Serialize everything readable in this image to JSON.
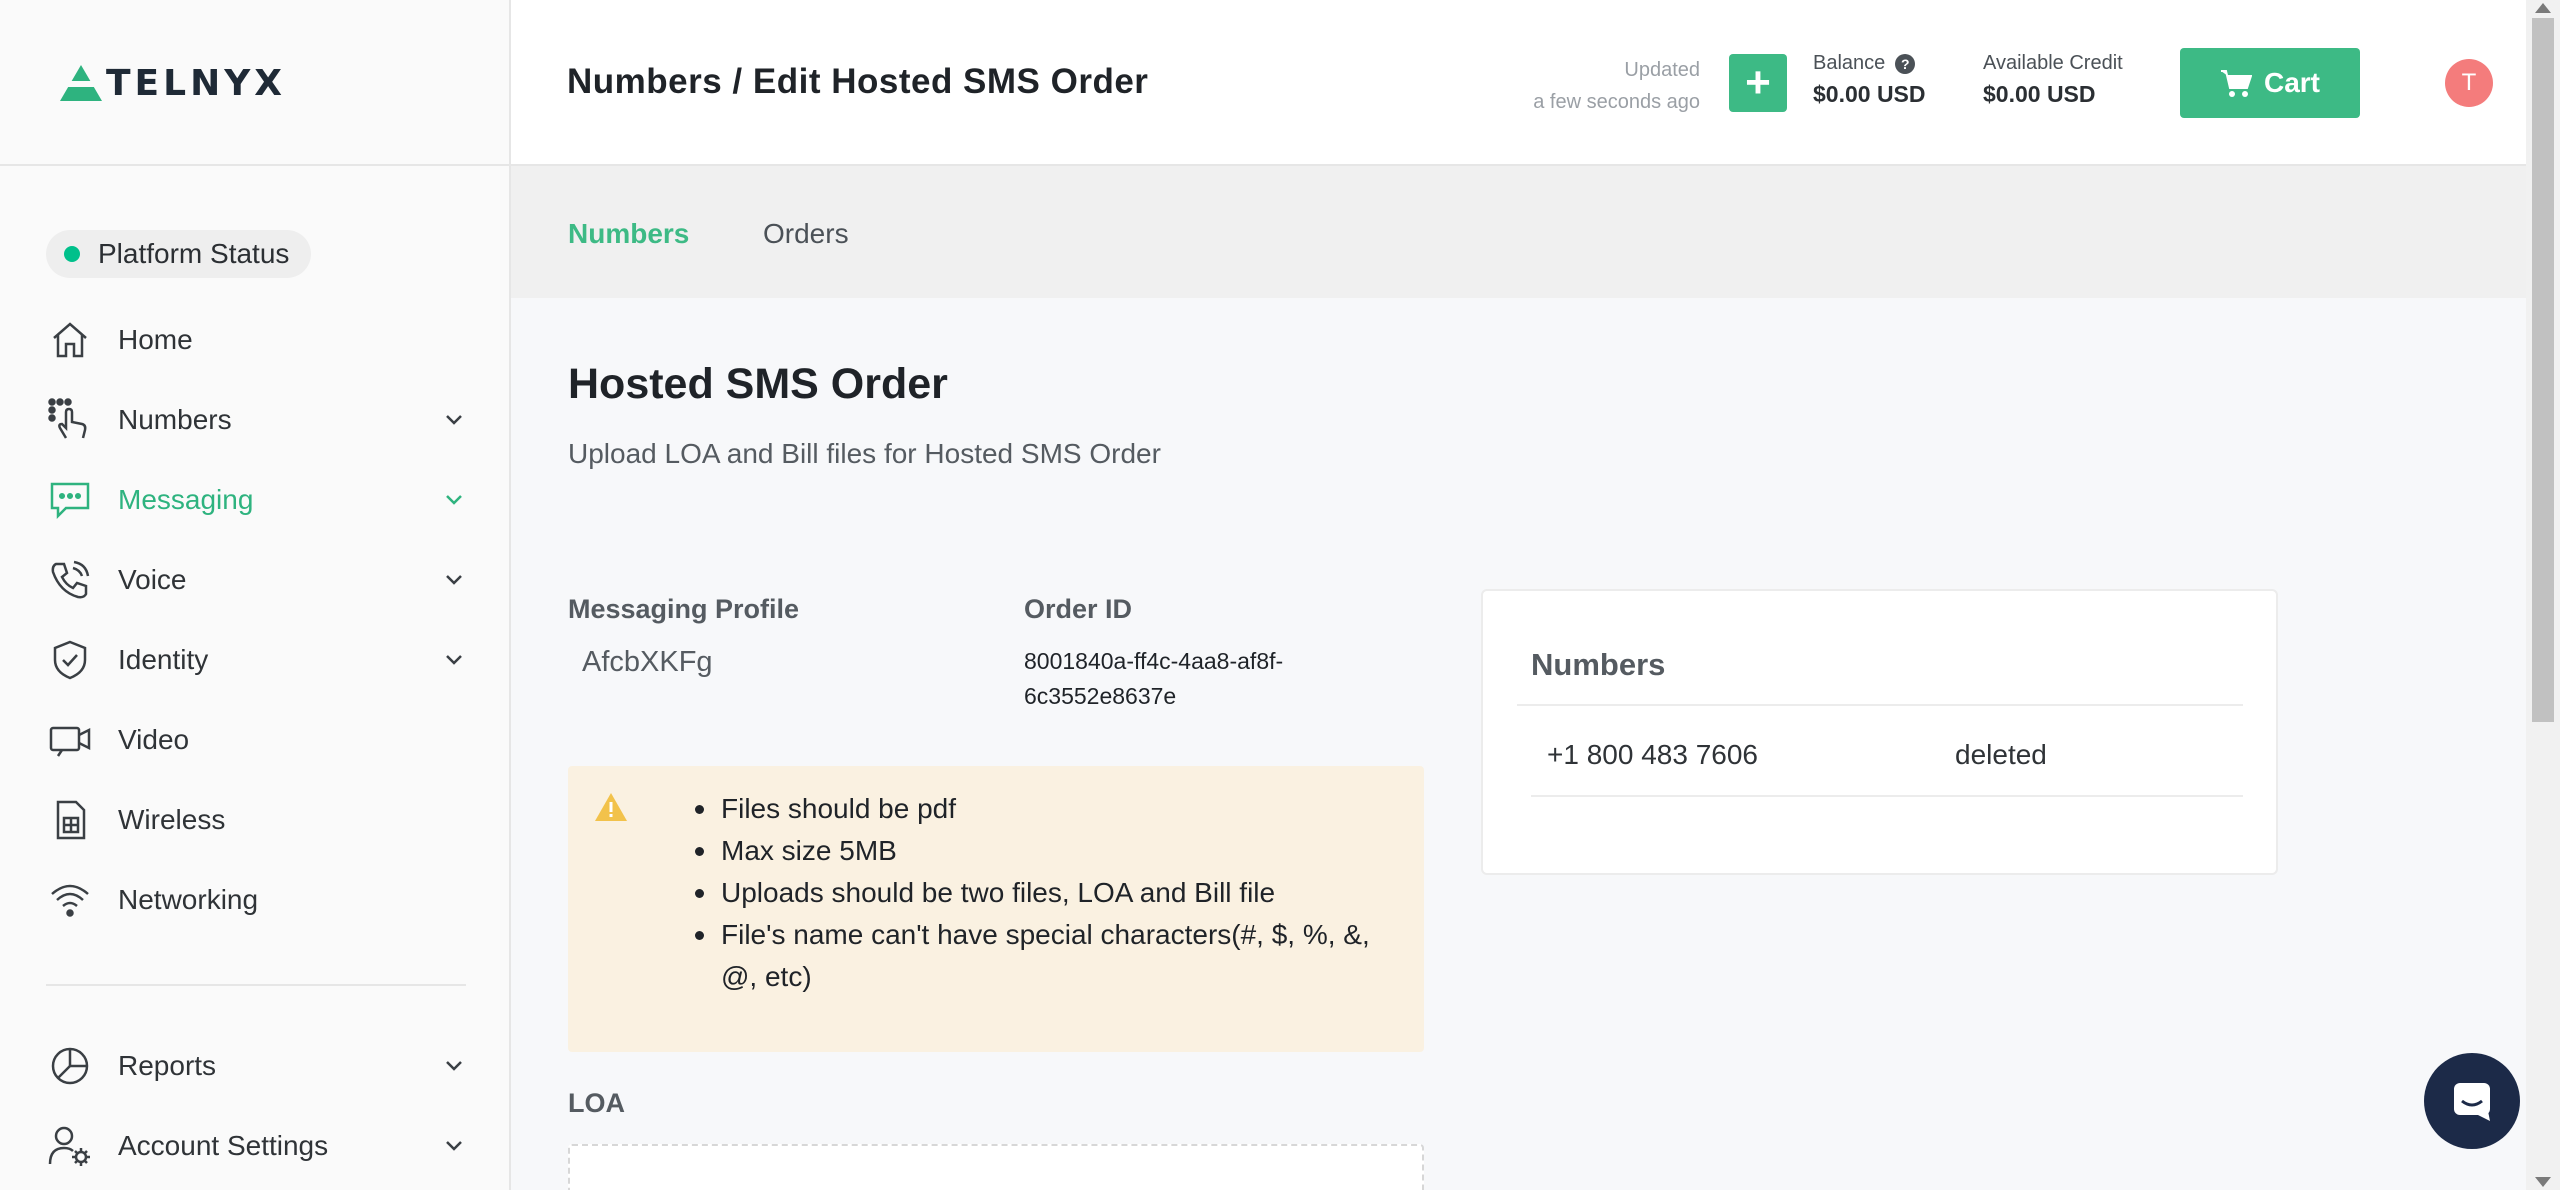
{
  "brand": {
    "name": "TELNYX",
    "accent": "#3dba85",
    "logo_color": "#1f2a36"
  },
  "sidebar": {
    "status": {
      "label": "Platform Status",
      "dot_color": "#00c08b"
    },
    "items": [
      {
        "label": "Home",
        "icon": "home-icon",
        "expandable": false,
        "active": false
      },
      {
        "label": "Numbers",
        "icon": "dialpad-touch-icon",
        "expandable": true,
        "active": false
      },
      {
        "label": "Messaging",
        "icon": "message-icon",
        "expandable": true,
        "active": true
      },
      {
        "label": "Voice",
        "icon": "phone-icon",
        "expandable": true,
        "active": false
      },
      {
        "label": "Identity",
        "icon": "shield-check-icon",
        "expandable": true,
        "active": false
      },
      {
        "label": "Video",
        "icon": "video-icon",
        "expandable": false,
        "active": false
      },
      {
        "label": "Wireless",
        "icon": "sim-card-icon",
        "expandable": false,
        "active": false
      },
      {
        "label": "Networking",
        "icon": "wifi-icon",
        "expandable": false,
        "active": false
      }
    ],
    "bottom_items": [
      {
        "label": "Reports",
        "icon": "pie-chart-icon",
        "expandable": true
      },
      {
        "label": "Account Settings",
        "icon": "user-gear-icon",
        "expandable": true
      }
    ]
  },
  "header": {
    "title": "Numbers / Edit Hosted SMS Order",
    "updated_label": "Updated",
    "updated_time": "a few seconds ago",
    "add_label": "+",
    "balance_label": "Balance",
    "balance_value": "$0.00 USD",
    "credit_label": "Available Credit",
    "credit_value": "$0.00 USD",
    "cart_label": "Cart",
    "avatar_initial": "T",
    "avatar_color": "#f47c7c"
  },
  "subnav": {
    "tabs": [
      {
        "label": "Numbers",
        "active": true
      },
      {
        "label": "Orders",
        "active": false
      }
    ]
  },
  "main": {
    "title": "Hosted SMS Order",
    "subtitle": "Upload LOA and Bill files for Hosted SMS Order",
    "messaging_profile_label": "Messaging Profile",
    "messaging_profile_value": "AfcbXKFg",
    "order_id_label": "Order ID",
    "order_id_value": "8001840a-ff4c-4aa8-af8f-6c3552e8637e",
    "warning_items": [
      "Files should be pdf",
      "Max size 5MB",
      "Uploads should be two files, LOA and Bill file",
      "File's name can't have special characters(#, $, %, &, @, etc)"
    ],
    "loa_label": "LOA"
  },
  "numbers_card": {
    "title": "Numbers",
    "rows": [
      {
        "number": "+1 800 483 7606",
        "status": "deleted"
      }
    ]
  }
}
